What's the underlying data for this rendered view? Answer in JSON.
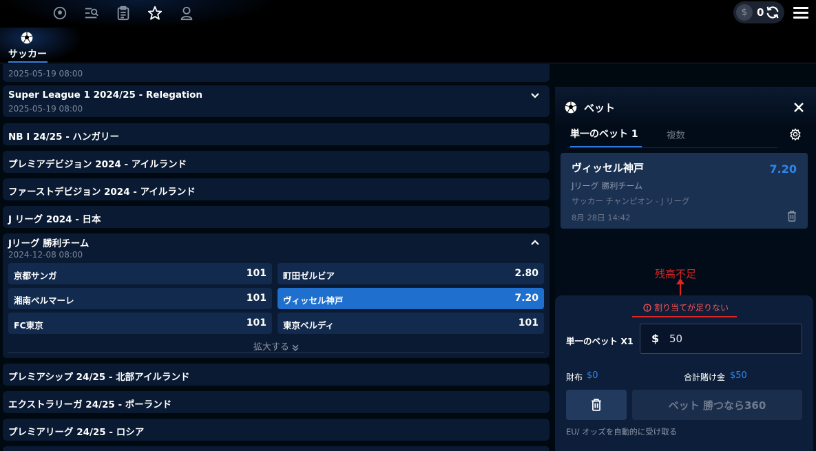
{
  "header": {
    "nav_icons": [
      "soccer-ball-icon",
      "search-list-icon",
      "clipboard-icon",
      "star-icon",
      "user-icon"
    ],
    "wallet_balance": "0",
    "currency_symbol": "$"
  },
  "sport_tab": {
    "label": "サッカー"
  },
  "leagues": [
    {
      "title": "",
      "date": "2025-05-19 08:00",
      "expanded": false
    },
    {
      "title": "Super League 1 2024/25 - Relegation",
      "date": "2025-05-19 08:00",
      "expanded": false
    },
    {
      "title": "NB I 24/25 - ハンガリー"
    },
    {
      "title": "プレミアデビジョン 2024 - アイルランド"
    },
    {
      "title": "ファーストデビジョン 2024 - アイルランド"
    },
    {
      "title": "J リーグ 2024 - 日本"
    },
    {
      "title": "Jリーグ 勝利チーム",
      "date": "2024-12-08 08:00",
      "expanded": true,
      "markets": [
        {
          "name": "京都サンガ",
          "odds": "101"
        },
        {
          "name": "町田ゼルビア",
          "odds": "2.80"
        },
        {
          "name": "湘南ベルマーレ",
          "odds": "101"
        },
        {
          "name": "ヴィッセル神戸",
          "odds": "7.20",
          "selected": true
        },
        {
          "name": "FC東京",
          "odds": "101"
        },
        {
          "name": "東京ベルディ",
          "odds": "101"
        }
      ],
      "expand_label": "拡大する"
    },
    {
      "title": "プレミアシップ 24/25 - 北部アイルランド"
    },
    {
      "title": "エクストラリーガ 24/25 - ポーランド"
    },
    {
      "title": "プレミアリーグ 24/25 - ロシア"
    }
  ],
  "betslip": {
    "title": "ベット",
    "tab_single": "単一のベット 1",
    "tab_multi": "複数",
    "selection": {
      "team": "ヴィッセル神戸",
      "odds": "7.20",
      "market": "Jリーグ 勝利チーム",
      "competition": "サッカー チャンピオン - J リーグ",
      "date": "8月 28日 14:42"
    },
    "annotation": "残高不足",
    "warning": "割り当てが足りない",
    "stake_label": "単一のベット X1",
    "stake_value": "50",
    "wallet_label": "財布",
    "wallet_value": "0",
    "total_label": "合計賭け金",
    "total_value": "50",
    "bet_button": "ベット 勝つなら360",
    "auto_accept": "EU/ オッズを自動的に受け取る"
  },
  "colors": {
    "accent": "#2f86ec",
    "selected": "#1f6fcf",
    "warning": "#e0241f"
  }
}
